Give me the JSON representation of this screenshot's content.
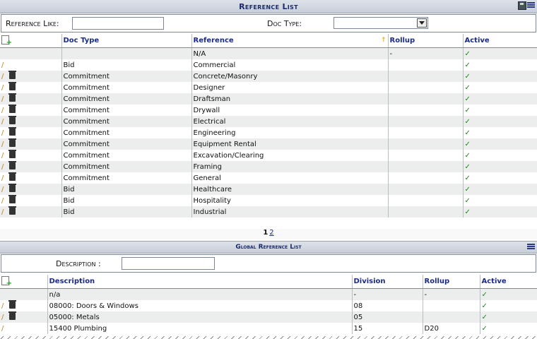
{
  "reference_list": {
    "title": "Reference List",
    "filter": {
      "reference_like_label": "Reference Like:",
      "reference_like_value": "",
      "doc_type_label": "Doc Type:",
      "doc_type_value": ""
    },
    "columns": {
      "doc_type": "Doc Type",
      "reference": "Reference",
      "rollup": "Rollup",
      "active": "Active"
    },
    "rows": [
      {
        "actions": "none",
        "doc_type": "",
        "reference": "N/A",
        "rollup": "-",
        "active": "✓"
      },
      {
        "actions": "edit",
        "doc_type": "Bid",
        "reference": "Commercial",
        "rollup": "",
        "active": "✓"
      },
      {
        "actions": "edit-delete",
        "doc_type": "Commitment",
        "reference": "Concrete/Masonry",
        "rollup": "",
        "active": "✓"
      },
      {
        "actions": "edit-delete",
        "doc_type": "Commitment",
        "reference": "Designer",
        "rollup": "",
        "active": "✓"
      },
      {
        "actions": "edit-delete",
        "doc_type": "Commitment",
        "reference": "Draftsman",
        "rollup": "",
        "active": "✓"
      },
      {
        "actions": "edit-delete",
        "doc_type": "Commitment",
        "reference": "Drywall",
        "rollup": "",
        "active": "✓"
      },
      {
        "actions": "edit-delete",
        "doc_type": "Commitment",
        "reference": "Electrical",
        "rollup": "",
        "active": "✓"
      },
      {
        "actions": "edit-delete",
        "doc_type": "Commitment",
        "reference": "Engineering",
        "rollup": "",
        "active": "✓"
      },
      {
        "actions": "edit-delete",
        "doc_type": "Commitment",
        "reference": "Equipment Rental",
        "rollup": "",
        "active": "✓"
      },
      {
        "actions": "edit-delete",
        "doc_type": "Commitment",
        "reference": "Excavation/Clearing",
        "rollup": "",
        "active": "✓"
      },
      {
        "actions": "edit-delete",
        "doc_type": "Commitment",
        "reference": "Framing",
        "rollup": "",
        "active": "✓"
      },
      {
        "actions": "edit-delete",
        "doc_type": "Commitment",
        "reference": "General",
        "rollup": "",
        "active": "✓"
      },
      {
        "actions": "edit-delete",
        "doc_type": "Bid",
        "reference": "Healthcare",
        "rollup": "",
        "active": "✓"
      },
      {
        "actions": "edit-delete",
        "doc_type": "Bid",
        "reference": "Hospitality",
        "rollup": "",
        "active": "✓"
      },
      {
        "actions": "edit-delete",
        "doc_type": "Bid",
        "reference": "Industrial",
        "rollup": "",
        "active": "✓"
      }
    ],
    "pager": {
      "current": "1",
      "next": "2"
    }
  },
  "global_reference_list": {
    "title": "Global Reference List",
    "filter": {
      "description_label": "Description :",
      "description_value": ""
    },
    "columns": {
      "description": "Description",
      "division": "Division",
      "rollup": "Rollup",
      "active": "Active"
    },
    "rows": [
      {
        "actions": "none",
        "description": "n/a",
        "division": "-",
        "rollup": "-",
        "active": "✓"
      },
      {
        "actions": "edit-delete",
        "description": "08000: Doors & Windows",
        "division": "08",
        "rollup": "",
        "active": "✓"
      },
      {
        "actions": "edit-delete",
        "description": "05000: Metals",
        "division": "05",
        "rollup": "",
        "active": "✓"
      },
      {
        "actions": "edit",
        "description": "15400 Plumbing",
        "division": "15",
        "rollup": "D20",
        "active": "✓"
      }
    ]
  }
}
